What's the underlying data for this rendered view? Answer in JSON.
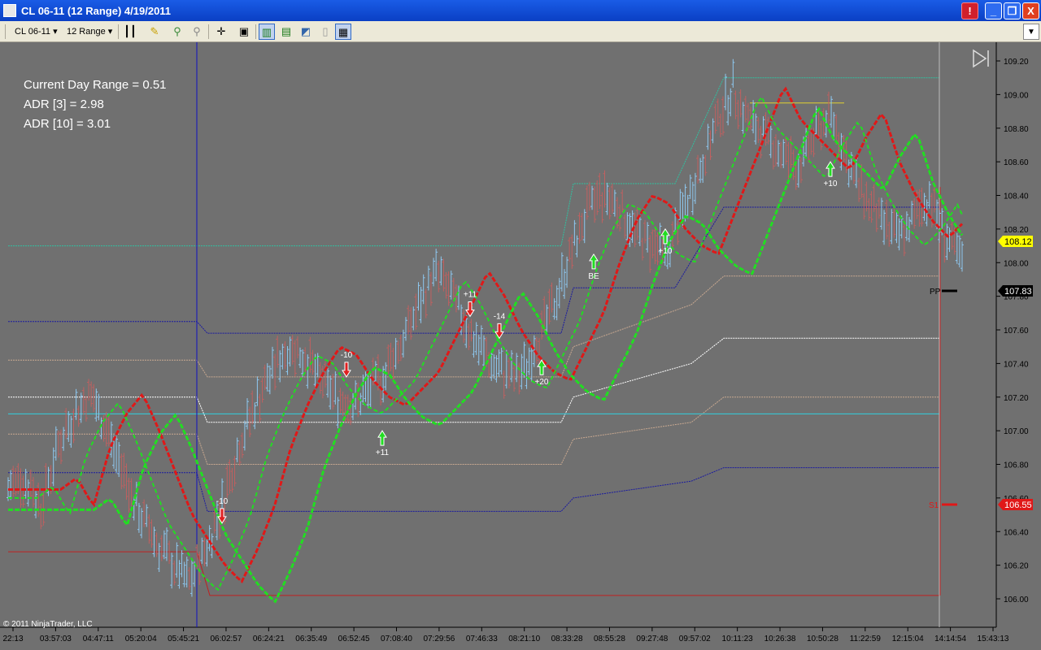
{
  "window": {
    "title": "CL 06-11  (12 Range)  4/19/2011",
    "min_label": "_",
    "max_label": "❐",
    "close_label": "X",
    "alert_label": "!"
  },
  "toolbar": {
    "instrument": "CL 06-11",
    "period": "12 Range"
  },
  "info": {
    "current_range": "Current Day Range = 0.51",
    "adr3": "ADR [3] = 2.98",
    "adr10": "ADR [10] = 3.01"
  },
  "copyright": "© 2011 NinjaTrader, LLC",
  "colors": {
    "background": "#707070",
    "up_bar": "#8ec8f0",
    "down_bar": "#c06060",
    "fast_ma": "#22dd22",
    "slow_ma": "#e01818",
    "neutral_ma": "#f0d000",
    "long_arrow": "#22dd22",
    "short_arrow": "#e02020",
    "last_price": "#ffff00",
    "pivot_label": "#000000",
    "s1_label": "#e01818"
  },
  "y_axis": {
    "ticks": [
      "109.20",
      "109.00",
      "108.80",
      "108.60",
      "108.40",
      "108.20",
      "108.00",
      "107.80",
      "107.60",
      "107.40",
      "107.20",
      "107.00",
      "106.80",
      "106.60",
      "106.40",
      "106.20",
      "106.00"
    ]
  },
  "x_axis": {
    "ticks": [
      "22:13",
      "03:57:03",
      "04:47:11",
      "05:20:04",
      "05:45:21",
      "06:02:57",
      "06:24:21",
      "06:35:49",
      "06:52:45",
      "07:08:40",
      "07:29:56",
      "07:46:33",
      "08:21:10",
      "08:33:28",
      "08:55:28",
      "09:27:48",
      "09:57:02",
      "10:11:23",
      "10:26:38",
      "10:50:28",
      "11:22:59",
      "12:15:04",
      "14:14:54",
      "15:43:13"
    ]
  },
  "price_labels": {
    "last": "108.12",
    "pp": "107.83",
    "s1": "106.55",
    "pp_tag": "PP",
    "s1_tag": "S1"
  },
  "chart_data": {
    "type": "candlestick",
    "instrument": "CL 06-11",
    "period": "12 Range",
    "date": "4/19/2011",
    "ylim": [
      105.95,
      109.25
    ],
    "ohlc_close_path": [
      106.65,
      106.72,
      106.55,
      106.9,
      107.1,
      107.22,
      107.0,
      106.75,
      106.5,
      106.35,
      106.2,
      106.1,
      106.3,
      106.55,
      106.9,
      107.15,
      107.35,
      107.5,
      107.45,
      107.3,
      107.2,
      107.15,
      107.25,
      107.35,
      107.55,
      107.75,
      107.95,
      107.8,
      107.6,
      107.45,
      107.35,
      107.3,
      107.5,
      107.7,
      108.0,
      108.25,
      108.4,
      108.35,
      108.2,
      108.1,
      108.05,
      108.3,
      108.55,
      108.8,
      109.05,
      108.85,
      108.75,
      108.65,
      108.55,
      108.75,
      108.9,
      108.6,
      108.4,
      108.25,
      108.15,
      108.25,
      108.4,
      108.15,
      108.0
    ],
    "signals": [
      {
        "type": "short",
        "label": "-10",
        "price": 106.45
      },
      {
        "type": "short",
        "label": "-10",
        "price": 107.32
      },
      {
        "type": "long",
        "label": "+11",
        "price": 107.0
      },
      {
        "type": "short",
        "label": "+11",
        "price": 107.68
      },
      {
        "type": "short",
        "label": "-14",
        "price": 107.55
      },
      {
        "type": "long",
        "label": "+20",
        "price": 107.42
      },
      {
        "type": "long",
        "label": "BE",
        "price": 108.05
      },
      {
        "type": "long",
        "label": "+10",
        "price": 108.2
      },
      {
        "type": "long",
        "label": "+10",
        "price": 108.6
      }
    ],
    "levels": {
      "last_price": 108.12,
      "pivot_pp": 107.83,
      "s1": 106.55
    }
  }
}
